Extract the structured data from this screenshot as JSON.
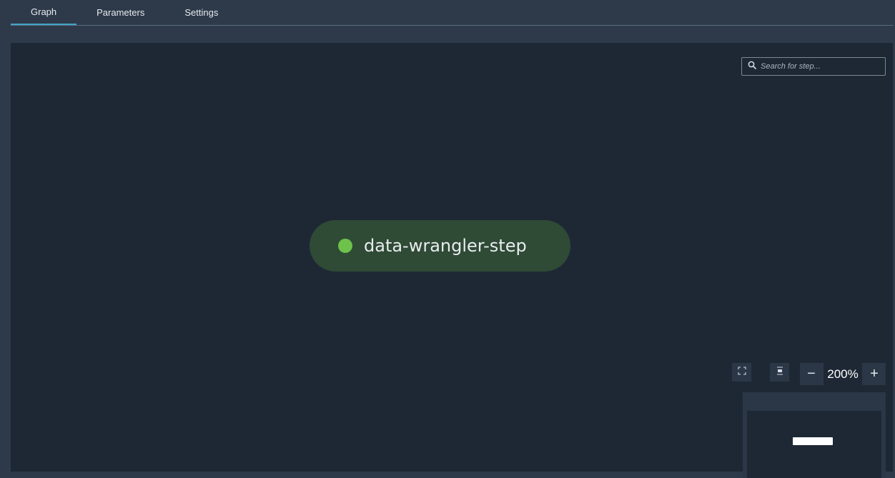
{
  "tabs": [
    {
      "label": "Graph",
      "active": true
    },
    {
      "label": "Parameters",
      "active": false
    },
    {
      "label": "Settings",
      "active": false
    }
  ],
  "search": {
    "placeholder": "Search for step...",
    "icon": "search-icon"
  },
  "node": {
    "label": "data-wrangler-step",
    "status_color": "#6cc24a"
  },
  "controls": {
    "fit_icon": "fit-view-icon",
    "center_icon": "center-view-icon",
    "zoom_out": "−",
    "zoom_level": "200%",
    "zoom_in": "+"
  },
  "colors": {
    "accent": "#3ea6c8",
    "canvas": "#1e2835",
    "node_fill": "#2f4a35"
  }
}
